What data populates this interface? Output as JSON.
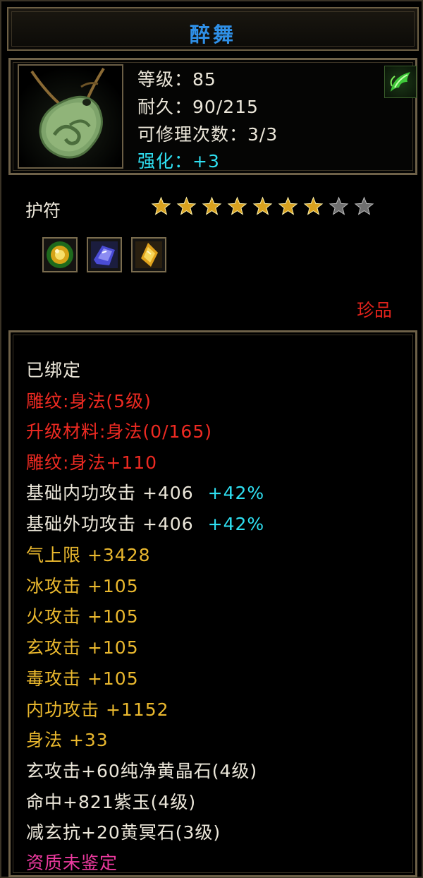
{
  "title": "醉舞",
  "colors": {
    "title": "#2f8fe6",
    "quality": "#e3231c",
    "red": "#ee2a22",
    "cyan": "#2fe0f2",
    "gold": "#eab82e",
    "pink": "#ee3aa0",
    "text": "#ece7da",
    "border": "#6e6148"
  },
  "header": {
    "image_icon": "jade-pendant-icon",
    "corner_icon": "green-leaf-icon",
    "level": "等级：85",
    "durability": "耐久：90/215",
    "repair_count": "可修理次数：3/3",
    "enhance": "强化：+3"
  },
  "item_type": "护符",
  "stars": {
    "filled": 7,
    "total": 9
  },
  "gems": [
    {
      "icon": "green-gold-orb-gem-icon"
    },
    {
      "icon": "purple-crystal-gem-icon"
    },
    {
      "icon": "yellow-crystal-gem-icon"
    }
  ],
  "quality": "珍品",
  "properties": {
    "bound": "已绑定",
    "engrave": "雕纹:身法(5级)",
    "upgrade_material": "升级材料:身法(0/165)",
    "engrave_bonus": "雕纹:身法+110",
    "base_inner_attack": {
      "label": "基础内功攻击 +406",
      "pct": "+42%"
    },
    "base_outer_attack": {
      "label": "基础外功攻击 +406",
      "pct": "+42%"
    },
    "qi_limit": "气上限 +3428",
    "ice_attack": "冰攻击 +105",
    "fire_attack": "火攻击 +105",
    "mystic_attack": "玄攻击 +105",
    "poison_attack": "毒攻击 +105",
    "inner_attack": "内功攻击 +1152",
    "agility": "身法 +33",
    "gem1": "玄攻击+60纯净黄晶石(4级)",
    "gem2": "命中+821紫玉(4级)",
    "gem3": "减玄抗+20黄冥石(3级)",
    "aptitude": "资质未鉴定"
  }
}
